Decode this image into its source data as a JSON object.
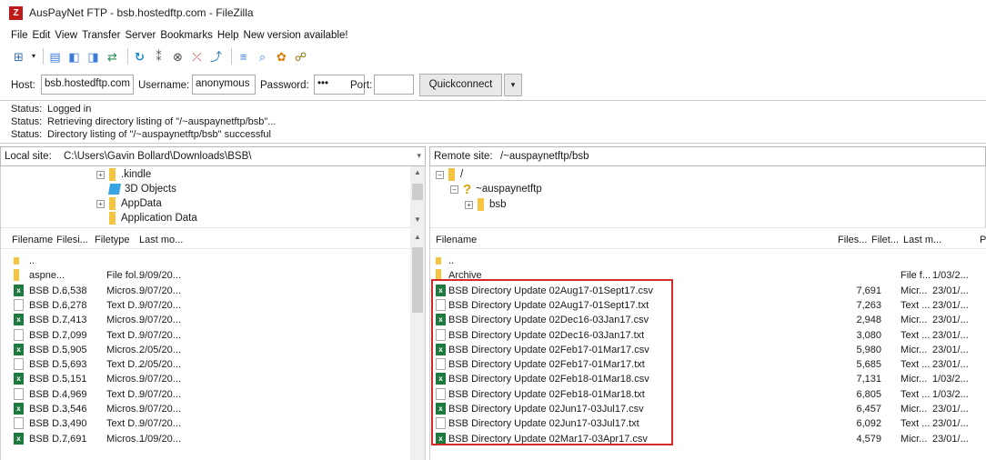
{
  "window": {
    "title": "AusPayNet FTP - bsb.hostedftp.com - FileZilla",
    "icon_letter": "Z"
  },
  "menu": [
    "File",
    "Edit",
    "View",
    "Transfer",
    "Server",
    "Bookmarks",
    "Help",
    "New version available!"
  ],
  "quickconnect": {
    "host_label": "Host:",
    "host_value": "bsb.hostedftp.com",
    "username_label": "Username:",
    "username_value": "anonymous",
    "password_label": "Password:",
    "password_value": "•••",
    "port_label": "Port:",
    "port_value": "",
    "button_label": "Quickconnect",
    "dropdown_glyph": "▾"
  },
  "status_log": [
    {
      "label": "Status:",
      "message": "Logged in"
    },
    {
      "label": "Status:",
      "message": "Retrieving directory listing of \"/~auspaynetftp/bsb\"..."
    },
    {
      "label": "Status:",
      "message": "Directory listing of \"/~auspaynetftp/bsb\" successful"
    }
  ],
  "local": {
    "site_label": "Local site:",
    "site_path": "C:\\Users\\Gavin Bollard\\Downloads\\BSB\\",
    "tree": [
      {
        "label": ".kindle",
        "expander": "+"
      },
      {
        "label": "3D Objects",
        "expander": ""
      },
      {
        "label": "AppData",
        "expander": "+"
      },
      {
        "label": "Application Data",
        "expander": ""
      }
    ],
    "columns": [
      "Filename",
      "Filesi...",
      "Filetype",
      "Last mo..."
    ],
    "rows": [
      {
        "icon": "up",
        "name": "..",
        "size": "",
        "type": "",
        "modified": ""
      },
      {
        "icon": "folder",
        "name": "aspne...",
        "size": "",
        "type": "File fol...",
        "modified": "9/09/20..."
      },
      {
        "icon": "csv",
        "name": "BSB D...",
        "size": "6,538",
        "type": "Micros...",
        "modified": "9/07/20..."
      },
      {
        "icon": "txt",
        "name": "BSB D...",
        "size": "6,278",
        "type": "Text D...",
        "modified": "9/07/20..."
      },
      {
        "icon": "csv",
        "name": "BSB D...",
        "size": "7,413",
        "type": "Micros...",
        "modified": "9/07/20..."
      },
      {
        "icon": "txt",
        "name": "BSB D...",
        "size": "7,099",
        "type": "Text D...",
        "modified": "9/07/20..."
      },
      {
        "icon": "csv",
        "name": "BSB D...",
        "size": "5,905",
        "type": "Micros...",
        "modified": "2/05/20..."
      },
      {
        "icon": "txt",
        "name": "BSB D...",
        "size": "5,693",
        "type": "Text D...",
        "modified": "2/05/20..."
      },
      {
        "icon": "csv",
        "name": "BSB D...",
        "size": "5,151",
        "type": "Micros...",
        "modified": "9/07/20..."
      },
      {
        "icon": "txt",
        "name": "BSB D...",
        "size": "4,969",
        "type": "Text D...",
        "modified": "9/07/20..."
      },
      {
        "icon": "csv",
        "name": "BSB D...",
        "size": "3,546",
        "type": "Micros...",
        "modified": "9/07/20..."
      },
      {
        "icon": "txt",
        "name": "BSB D...",
        "size": "3,490",
        "type": "Text D...",
        "modified": "9/07/20..."
      },
      {
        "icon": "csv",
        "name": "BSB D...",
        "size": "7,691",
        "type": "Micros...",
        "modified": "1/09/20..."
      }
    ]
  },
  "remote": {
    "site_label": "Remote site:",
    "site_path": "/~auspaynetftp/bsb",
    "tree": [
      {
        "label": "/",
        "expander": "−",
        "icon": "folder"
      },
      {
        "label": "~auspaynetftp",
        "expander": "−",
        "icon": "question"
      },
      {
        "label": "bsb",
        "expander": "+",
        "icon": "folder"
      }
    ],
    "columns": [
      "Filename",
      "Files...",
      "Filet...",
      "Last m...",
      "P"
    ],
    "rows": [
      {
        "icon": "up",
        "name": "..",
        "size": "",
        "type": "",
        "modified": ""
      },
      {
        "icon": "folder",
        "name": "Archive",
        "size": "",
        "type": "File f...",
        "modified": "1/03/2..."
      },
      {
        "icon": "csv",
        "name": "BSB Directory Update 02Aug17-01Sept17.csv",
        "size": "7,691",
        "type": "Micr...",
        "modified": "23/01/..."
      },
      {
        "icon": "txt",
        "name": "BSB Directory Update 02Aug17-01Sept17.txt",
        "size": "7,263",
        "type": "Text ...",
        "modified": "23/01/..."
      },
      {
        "icon": "csv",
        "name": "BSB Directory Update 02Dec16-03Jan17.csv",
        "size": "2,948",
        "type": "Micr...",
        "modified": "23/01/..."
      },
      {
        "icon": "txt",
        "name": "BSB Directory Update 02Dec16-03Jan17.txt",
        "size": "3,080",
        "type": "Text ...",
        "modified": "23/01/..."
      },
      {
        "icon": "csv",
        "name": "BSB Directory Update 02Feb17-01Mar17.csv",
        "size": "5,980",
        "type": "Micr...",
        "modified": "23/01/..."
      },
      {
        "icon": "txt",
        "name": "BSB Directory Update 02Feb17-01Mar17.txt",
        "size": "5,685",
        "type": "Text ...",
        "modified": "23/01/..."
      },
      {
        "icon": "csv",
        "name": "BSB Directory Update 02Feb18-01Mar18.csv",
        "size": "7,131",
        "type": "Micr...",
        "modified": "1/03/2..."
      },
      {
        "icon": "txt",
        "name": "BSB Directory Update 02Feb18-01Mar18.txt",
        "size": "6,805",
        "type": "Text ...",
        "modified": "1/03/2..."
      },
      {
        "icon": "csv",
        "name": "BSB Directory Update 02Jun17-03Jul17.csv",
        "size": "6,457",
        "type": "Micr...",
        "modified": "23/01/..."
      },
      {
        "icon": "txt",
        "name": "BSB Directory Update 02Jun17-03Jul17.txt",
        "size": "6,092",
        "type": "Text ...",
        "modified": "23/01/..."
      },
      {
        "icon": "csv",
        "name": "BSB Directory Update 02Mar17-03Apr17.csv",
        "size": "4,579",
        "type": "Micr...",
        "modified": "23/01/..."
      }
    ]
  },
  "colors": {
    "highlight_border": "#d42a2a",
    "folder": "#f5c542",
    "csv_icon": "#1d7a3f",
    "app_icon": "#bf1b1b"
  }
}
